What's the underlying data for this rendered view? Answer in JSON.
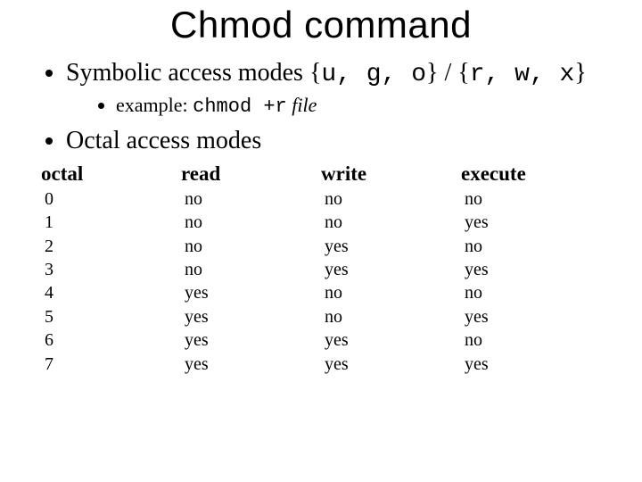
{
  "title": "Chmod command",
  "bullets": {
    "symbolic_prefix": "Symbolic access modes {",
    "symbolic_set1": "u, g, o",
    "symbolic_mid": "} / {",
    "symbolic_set2": "r, w, x",
    "symbolic_suffix": "}",
    "example_prefix": "example: ",
    "example_cmd": "chmod +r",
    "example_file": " file",
    "octal_label": "Octal access modes"
  },
  "table": {
    "headers": [
      "octal",
      "read",
      "write",
      "execute"
    ],
    "rows": [
      [
        "0",
        "no",
        "no",
        "no"
      ],
      [
        "1",
        "no",
        "no",
        "yes"
      ],
      [
        "2",
        "no",
        "yes",
        "no"
      ],
      [
        "3",
        "no",
        "yes",
        "yes"
      ],
      [
        "4",
        "yes",
        "no",
        "no"
      ],
      [
        "5",
        "yes",
        "no",
        "yes"
      ],
      [
        "6",
        "yes",
        "yes",
        "no"
      ],
      [
        "7",
        "yes",
        "yes",
        "yes"
      ]
    ]
  }
}
